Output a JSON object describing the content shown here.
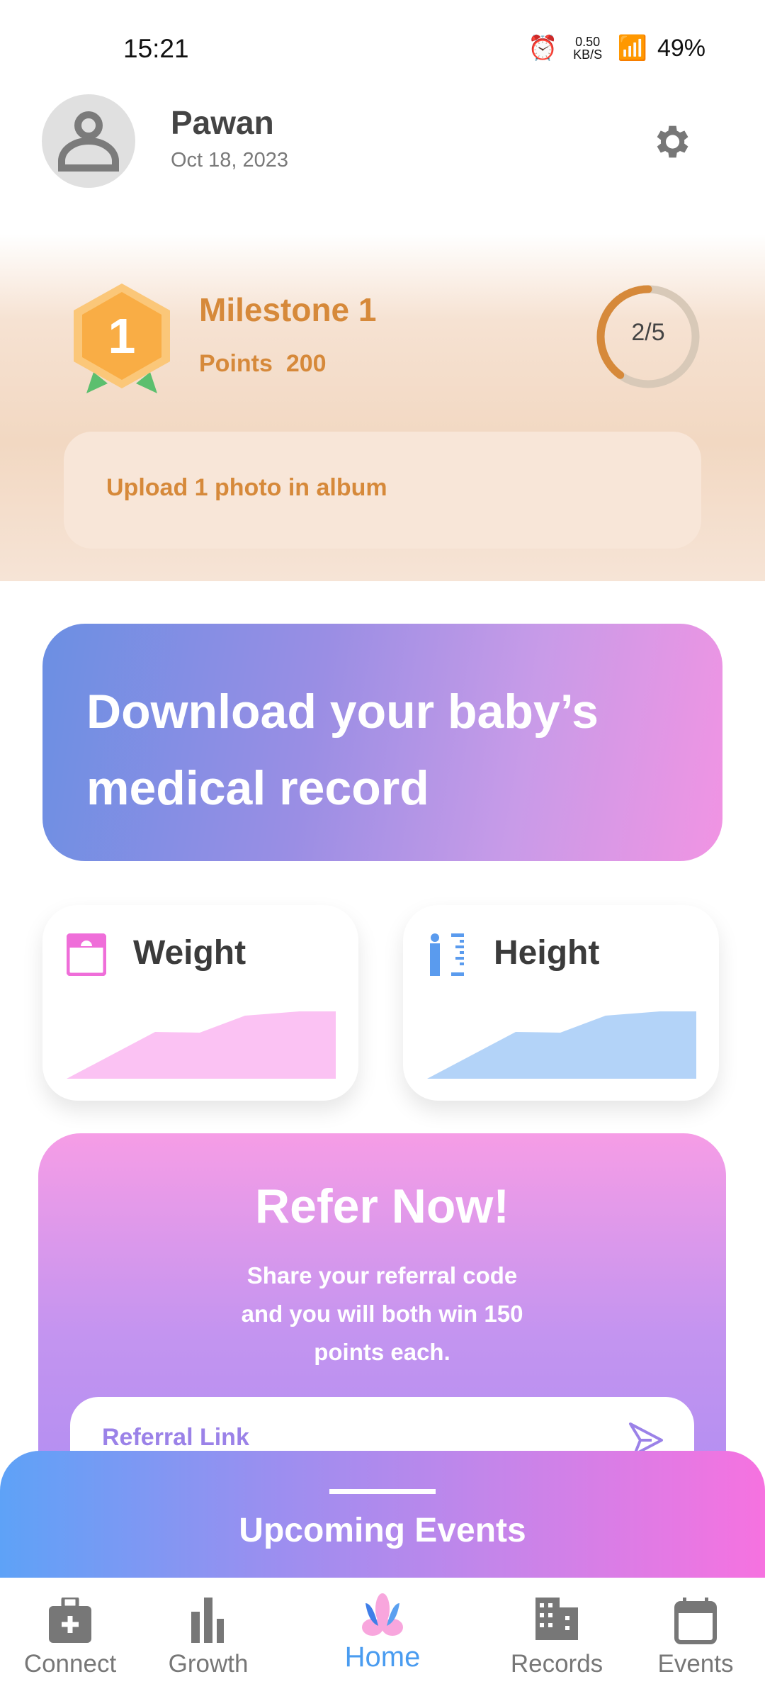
{
  "status_bar": {
    "time": "15:21",
    "net_speed": "0.50 KB/S",
    "battery": "49%"
  },
  "header": {
    "name": "Pawan",
    "date": "Oct 18, 2023",
    "icons": [
      "avatar-icon",
      "gear-icon"
    ]
  },
  "milestone": {
    "title": "Milestone 1",
    "points_label": "Points",
    "points": "200",
    "badge_number": "1",
    "progress_text": "2/5",
    "progress_fraction": 0.4,
    "task": "Upload 1 photo in album",
    "accent": "#d6893a"
  },
  "banner": {
    "text": "Download your baby’s medical record"
  },
  "cards": [
    {
      "label": "Weight",
      "icon": "scale-icon",
      "color": "#fbc2f3"
    },
    {
      "label": "Height",
      "icon": "height-icon",
      "color": "#b3d3f8"
    }
  ],
  "refer": {
    "title": "Refer Now!",
    "body": "Share your referral code and you will both win 150 points each.",
    "input_placeholder": "Referral Link"
  },
  "sheet": {
    "title": "Upcoming Events"
  },
  "nav": [
    {
      "label": "Connect",
      "icon": "medical-bag-icon"
    },
    {
      "label": "Growth",
      "icon": "bar-chart-icon"
    },
    {
      "label": "Home",
      "icon": "lotus-icon",
      "active": true
    },
    {
      "label": "Records",
      "icon": "building-icon"
    },
    {
      "label": "Events",
      "icon": "calendar-icon"
    }
  ]
}
